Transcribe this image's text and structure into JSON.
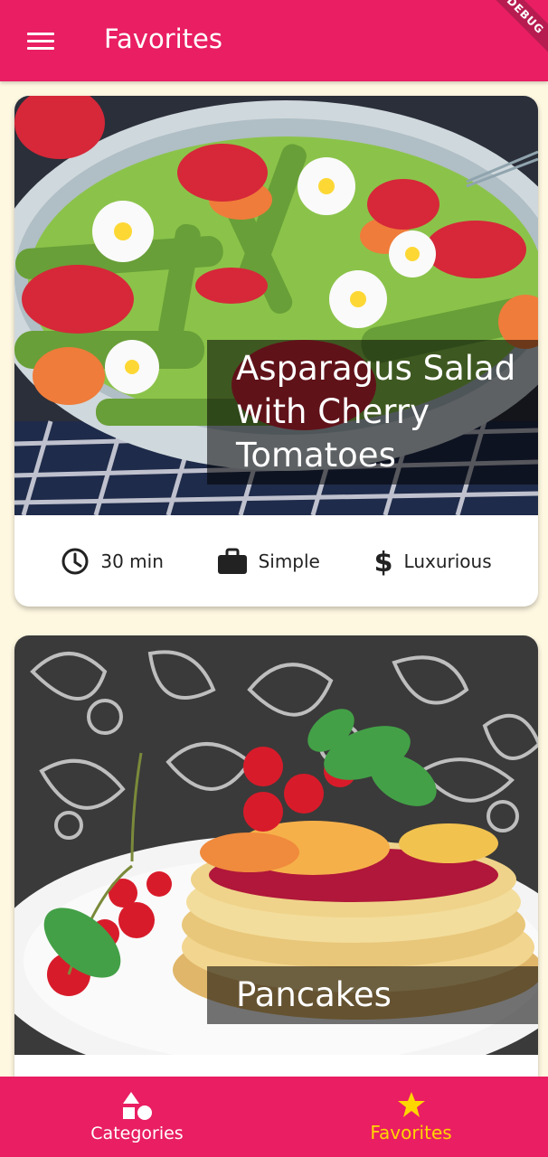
{
  "appbar": {
    "title": "Favorites",
    "debug_badge": "DEBUG"
  },
  "meals": [
    {
      "title": "Asparagus Salad with Cherry Tomatoes",
      "duration": "30 min",
      "complexity": "Simple",
      "affordability": "Luxurious"
    },
    {
      "title": "Pancakes"
    }
  ],
  "bottom_nav": {
    "tabs": [
      {
        "label": "Categories",
        "icon": "category-shapes-icon",
        "active": false
      },
      {
        "label": "Favorites",
        "icon": "star-icon",
        "active": true
      }
    ]
  },
  "colors": {
    "primary": "#E91E63",
    "background": "#FFF8E1",
    "active_tab": "#FFD600"
  }
}
